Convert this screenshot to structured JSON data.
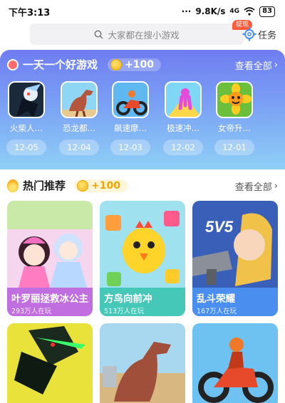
{
  "status_bar": {
    "time": "下午3:13",
    "dots": "···",
    "speed": "9.8K/s",
    "network": "4G",
    "battery": "83"
  },
  "search": {
    "placeholder": "大家都在搜小游戏",
    "badge": "提现",
    "task_label": "任务"
  },
  "daily": {
    "title": "一天一个好游戏",
    "reward": "+100",
    "see_all": "查看全部",
    "games": [
      {
        "name": "火柴人…",
        "date": "12-05"
      },
      {
        "name": "恐龙都…",
        "date": "12-04"
      },
      {
        "name": "飙速摩…",
        "date": "12-03"
      },
      {
        "name": "极速冲…",
        "date": "12-02"
      },
      {
        "name": "女帝升…",
        "date": "12-01"
      }
    ]
  },
  "hot": {
    "title": "热门推荐",
    "reward": "+100",
    "see_all": "查看全部",
    "cards": [
      {
        "name": "叶罗丽拯救冰公主",
        "players": "293万人在玩"
      },
      {
        "name": "方鸟向前冲",
        "players": "513万人在玩"
      },
      {
        "name": "乱斗荣耀",
        "players": "167万人在玩"
      },
      {
        "name": "",
        "players": ""
      },
      {
        "name": "",
        "players": ""
      },
      {
        "name": "",
        "players": ""
      }
    ],
    "card_art_text": "5V5"
  },
  "colors": {
    "daily_gradient_top": "#6f7cf0",
    "daily_gradient_bottom": "#8fd0f6",
    "card1_label": "#c06ee0",
    "card2_label": "#46c8b8",
    "card3_label": "#4a8ef0",
    "badge": "#ff5a3a",
    "coin": "#f5b80f"
  }
}
